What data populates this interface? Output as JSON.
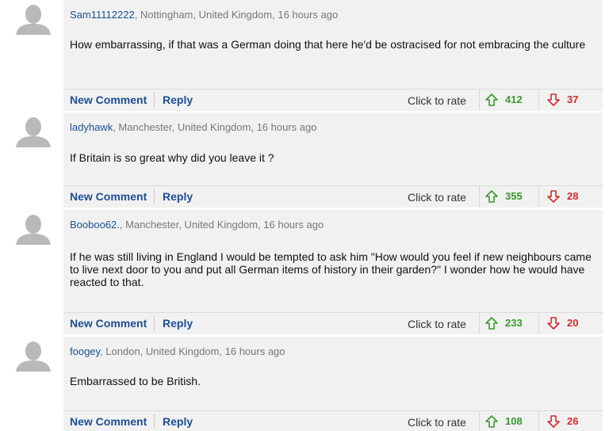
{
  "comments": [
    {
      "username": "Sam11112222",
      "location": ", Nottingham, United Kingdom, 16 hours ago",
      "text": "How embarrassing, if that was a German doing that here he'd be ostracised for not embracing the culture",
      "new_comment_label": "New Comment",
      "reply_label": "Reply",
      "rate_label": "Click to rate",
      "upvotes": "412",
      "downvotes": "37"
    },
    {
      "username": "ladyhawk",
      "location": ", Manchester, United Kingdom, 16 hours ago",
      "text": "If Britain is so great why did you leave it ?",
      "new_comment_label": "New Comment",
      "reply_label": "Reply",
      "rate_label": "Click to rate",
      "upvotes": "355",
      "downvotes": "28"
    },
    {
      "username": "Booboo62.",
      "location": ", Manchester, United Kingdom, 16 hours ago",
      "text": "If he was still living in England I would be tempted to ask him \"How would you feel if new neighbours came to live next door to you and put all German items of history in their garden?\" I wonder how he would have reacted to that.",
      "new_comment_label": "New Comment",
      "reply_label": "Reply",
      "rate_label": "Click to rate",
      "upvotes": "233",
      "downvotes": "20"
    },
    {
      "username": "foogey",
      "location": ", London, United Kingdom, 16 hours ago",
      "text": "Embarrassed to be British.",
      "new_comment_label": "New Comment",
      "reply_label": "Reply",
      "rate_label": "Click to rate",
      "upvotes": "108",
      "downvotes": "26"
    }
  ],
  "icons": {
    "avatar": "default-avatar-icon",
    "up": "arrow-up-icon",
    "down": "arrow-down-icon"
  },
  "colors": {
    "panel_bg": "#f1f1f1",
    "link": "#1d4f91",
    "up": "#3a9a2c",
    "down": "#d22b2b"
  }
}
